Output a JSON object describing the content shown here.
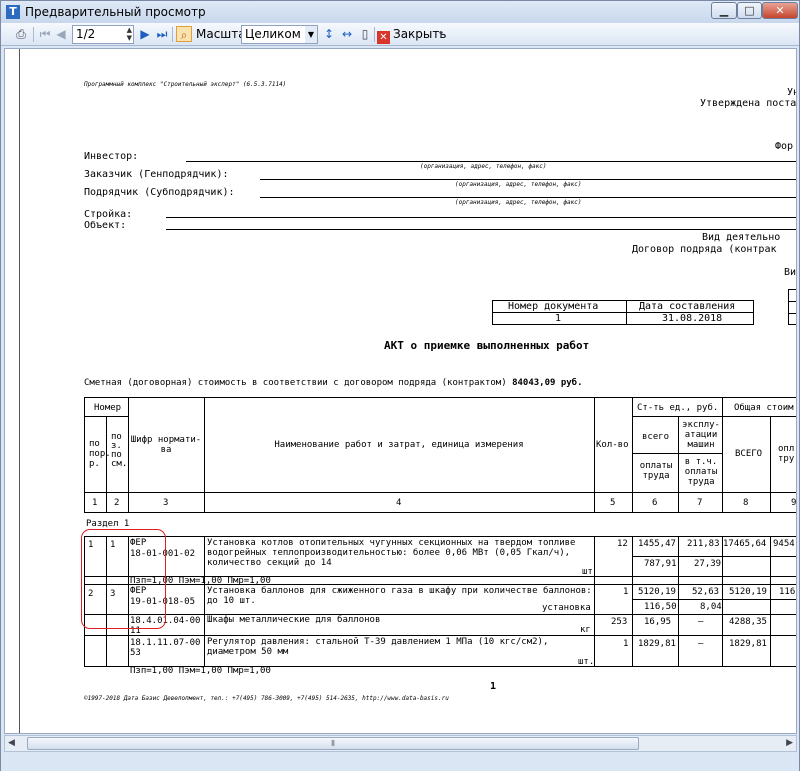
{
  "window": {
    "title": "Предварительный просмотр"
  },
  "toolbar": {
    "page_value": "1/2",
    "zoom_label": "Масштаб",
    "zoom_value": "Целиком",
    "close_label": "Закрыть"
  },
  "doc": {
    "program": "Программный комплекс \"Строительный эксперт\" (6.5.3.7114)",
    "top_right_1": "Ун",
    "top_right_2": "Утверждена постано",
    "form_label": "Фор",
    "investor": "Инвестор:",
    "customer": "Заказчик (Генподрядчик):",
    "contractor": "Подрядчик (Субподрядчик):",
    "construction": "Стройка:",
    "object": "Объект:",
    "hint_org": "(организация, адрес, телефон, факс)",
    "activity": "Вид деятельно",
    "contract": "Договор подряда (контрак",
    "vi": "Ви",
    "doc_number_header": "Номер документа",
    "date_header": "Дата составления",
    "doc_number": "1",
    "doc_date": "31.08.2018",
    "act_title": "АКТ о приемке выполненных работ",
    "estimate_text": "Сметная (договорная) стоимость в соответствии с договором подряда (контрактом)",
    "estimate_value": "84043,09 руб.",
    "page_number": "1",
    "footer": "©1997-2018 Дата Базис Девелопмент, тел.: +7(495) 786-3009, +7(495) 514-2635, http://www.data-basis.ru"
  },
  "table": {
    "h_number": "Номер",
    "h_pos_1": "по",
    "h_pos_2": "пор.",
    "h_pos_3": "р.",
    "h_pos2_1": "по",
    "h_pos2_2": "з.",
    "h_pos2_3": "по",
    "h_pos2_4": "см.",
    "h_code": "Шифр нормати-ва",
    "h_name": "Наименование работ и затрат, единица измерения",
    "h_qty": "Кол-во",
    "h_unit_cost": "Ст-ть ед., руб.",
    "h_total_cost": "Общая стоим",
    "h_all": "всего",
    "h_machine": "эксплу-атации машин",
    "h_labor": "оплаты труда",
    "h_incl": "в т.ч. оплаты труда",
    "h_total_all": "ВСЕГО",
    "h_opl": "опл тру",
    "col_nums": [
      "1",
      "2",
      "3",
      "4",
      "5",
      "6",
      "7",
      "8",
      "9"
    ],
    "section": "Раздел 1",
    "rows": [
      {
        "n1": "1",
        "n2": "1",
        "code_1": "ФЕР",
        "code_2": "18-01-001-02",
        "name": "Установка котлов отопительных чугунных секционных на твердом топливе водогрейных теплопроизводительностью: более 0,06 МВт (0,05 Гкал/ч), количество секций до 14",
        "unit": "шт",
        "qty": "12",
        "c6a": "1455,47",
        "c6b": "787,91",
        "c7a": "211,83",
        "c7b": "27,39",
        "c8": "17465,64",
        "c9": "9454",
        "coef": "Пзп=1,00 Пэм=1,00 Пмр=1,00"
      },
      {
        "n1": "2",
        "n2": "3",
        "code_1": "ФЕР",
        "code_2": "19-01-018-05",
        "name": "Установка баллонов для сжиженного газа в шкафу при количестве баллонов: до 10 шт.",
        "unit": "установка",
        "qty": "1",
        "c6a": "5120,19",
        "c6b": "116,50",
        "c7a": "52,63",
        "c7b": "8,04",
        "c8": "5120,19",
        "c9": "116"
      },
      {
        "code_2": "18.4.01.04-00",
        "code_3": "11",
        "name": "Шкафы металлические для баллонов",
        "unit": "кг",
        "qty": "253",
        "c6a": "16,95",
        "c7a": "–",
        "c8": "4288,35",
        "c9": "–"
      },
      {
        "code_2": "18.1.11.07-00",
        "code_3": "53",
        "name": "Регулятор давления: стальной Т-39 давлением 1 МПа (10 кгс/см2), диаметром 50 мм",
        "unit": "шт.",
        "qty": "1",
        "c6a": "1829,81",
        "c7a": "–",
        "c8": "1829,81",
        "c9": "–",
        "coef": "Пзп=1,00 Пэм=1,00 Пмр=1,00"
      }
    ]
  }
}
